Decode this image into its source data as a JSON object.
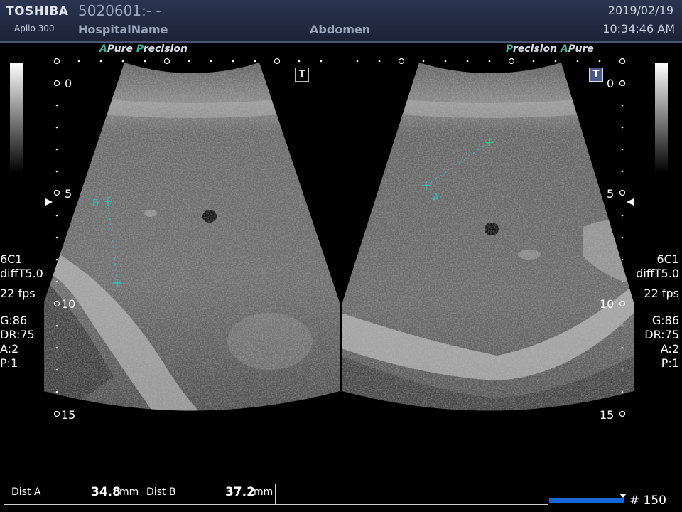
{
  "header": {
    "brand": "TOSHIBA",
    "model": "Aplio 300",
    "patient_id": "5020601:- -",
    "hospital": "HospitalName",
    "exam": "Abdomen",
    "date": "2019/02/19",
    "time": "10:34:46 AM"
  },
  "left_image": {
    "tag_a": "A",
    "tag_pure": "Pure",
    "tag_p": "P",
    "tag_precision": "recision",
    "marker": "T",
    "caliper_label": "B"
  },
  "right_image": {
    "tag_p": "P",
    "tag_precision": "recision",
    "tag_a": "A",
    "tag_pure": "Pure",
    "marker": "T",
    "caliper_label": "A"
  },
  "depth_scale": {
    "d0": "0",
    "d5": "5",
    "d10": "10",
    "d15": "15"
  },
  "left_params": {
    "probe": "6C1",
    "mode": "diffT5.0",
    "fps": "22 fps",
    "gain": "G:86",
    "dr": "DR:75",
    "a": "A:2",
    "p": "P:1"
  },
  "right_params": {
    "probe": "6C1",
    "mode": "diffT5.0",
    "fps": "22 fps",
    "gain": "G:86",
    "dr": "DR:75",
    "a": "A:2",
    "p": "P:1"
  },
  "measurements": {
    "dist_a_label": "Dist A",
    "dist_a_value": "34.8",
    "dist_a_unit": "mm",
    "dist_b_label": "Dist B",
    "dist_b_value": "37.2",
    "dist_b_unit": "mm"
  },
  "cine": {
    "frame": "# 150",
    "progress": 1.0
  },
  "colors": {
    "caliper": "#27c4c0",
    "caliper_green": "#32d07a",
    "tag": "#34b8a6",
    "cine_bar": "#1668d8"
  }
}
